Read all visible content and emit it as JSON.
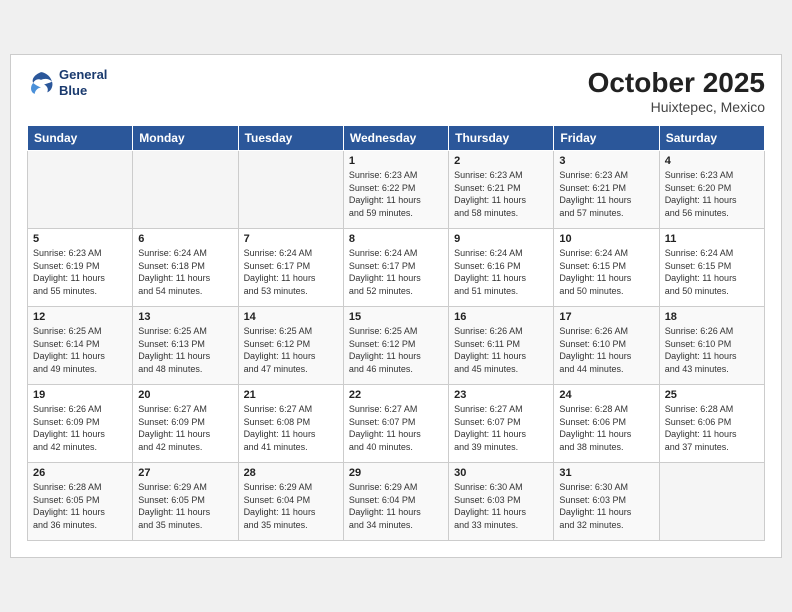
{
  "header": {
    "logo_line1": "General",
    "logo_line2": "Blue",
    "month": "October 2025",
    "location": "Huixtepec, Mexico"
  },
  "weekdays": [
    "Sunday",
    "Monday",
    "Tuesday",
    "Wednesday",
    "Thursday",
    "Friday",
    "Saturday"
  ],
  "weeks": [
    [
      {
        "day": "",
        "info": ""
      },
      {
        "day": "",
        "info": ""
      },
      {
        "day": "",
        "info": ""
      },
      {
        "day": "1",
        "info": "Sunrise: 6:23 AM\nSunset: 6:22 PM\nDaylight: 11 hours\nand 59 minutes."
      },
      {
        "day": "2",
        "info": "Sunrise: 6:23 AM\nSunset: 6:21 PM\nDaylight: 11 hours\nand 58 minutes."
      },
      {
        "day": "3",
        "info": "Sunrise: 6:23 AM\nSunset: 6:21 PM\nDaylight: 11 hours\nand 57 minutes."
      },
      {
        "day": "4",
        "info": "Sunrise: 6:23 AM\nSunset: 6:20 PM\nDaylight: 11 hours\nand 56 minutes."
      }
    ],
    [
      {
        "day": "5",
        "info": "Sunrise: 6:23 AM\nSunset: 6:19 PM\nDaylight: 11 hours\nand 55 minutes."
      },
      {
        "day": "6",
        "info": "Sunrise: 6:24 AM\nSunset: 6:18 PM\nDaylight: 11 hours\nand 54 minutes."
      },
      {
        "day": "7",
        "info": "Sunrise: 6:24 AM\nSunset: 6:17 PM\nDaylight: 11 hours\nand 53 minutes."
      },
      {
        "day": "8",
        "info": "Sunrise: 6:24 AM\nSunset: 6:17 PM\nDaylight: 11 hours\nand 52 minutes."
      },
      {
        "day": "9",
        "info": "Sunrise: 6:24 AM\nSunset: 6:16 PM\nDaylight: 11 hours\nand 51 minutes."
      },
      {
        "day": "10",
        "info": "Sunrise: 6:24 AM\nSunset: 6:15 PM\nDaylight: 11 hours\nand 50 minutes."
      },
      {
        "day": "11",
        "info": "Sunrise: 6:24 AM\nSunset: 6:15 PM\nDaylight: 11 hours\nand 50 minutes."
      }
    ],
    [
      {
        "day": "12",
        "info": "Sunrise: 6:25 AM\nSunset: 6:14 PM\nDaylight: 11 hours\nand 49 minutes."
      },
      {
        "day": "13",
        "info": "Sunrise: 6:25 AM\nSunset: 6:13 PM\nDaylight: 11 hours\nand 48 minutes."
      },
      {
        "day": "14",
        "info": "Sunrise: 6:25 AM\nSunset: 6:12 PM\nDaylight: 11 hours\nand 47 minutes."
      },
      {
        "day": "15",
        "info": "Sunrise: 6:25 AM\nSunset: 6:12 PM\nDaylight: 11 hours\nand 46 minutes."
      },
      {
        "day": "16",
        "info": "Sunrise: 6:26 AM\nSunset: 6:11 PM\nDaylight: 11 hours\nand 45 minutes."
      },
      {
        "day": "17",
        "info": "Sunrise: 6:26 AM\nSunset: 6:10 PM\nDaylight: 11 hours\nand 44 minutes."
      },
      {
        "day": "18",
        "info": "Sunrise: 6:26 AM\nSunset: 6:10 PM\nDaylight: 11 hours\nand 43 minutes."
      }
    ],
    [
      {
        "day": "19",
        "info": "Sunrise: 6:26 AM\nSunset: 6:09 PM\nDaylight: 11 hours\nand 42 minutes."
      },
      {
        "day": "20",
        "info": "Sunrise: 6:27 AM\nSunset: 6:09 PM\nDaylight: 11 hours\nand 42 minutes."
      },
      {
        "day": "21",
        "info": "Sunrise: 6:27 AM\nSunset: 6:08 PM\nDaylight: 11 hours\nand 41 minutes."
      },
      {
        "day": "22",
        "info": "Sunrise: 6:27 AM\nSunset: 6:07 PM\nDaylight: 11 hours\nand 40 minutes."
      },
      {
        "day": "23",
        "info": "Sunrise: 6:27 AM\nSunset: 6:07 PM\nDaylight: 11 hours\nand 39 minutes."
      },
      {
        "day": "24",
        "info": "Sunrise: 6:28 AM\nSunset: 6:06 PM\nDaylight: 11 hours\nand 38 minutes."
      },
      {
        "day": "25",
        "info": "Sunrise: 6:28 AM\nSunset: 6:06 PM\nDaylight: 11 hours\nand 37 minutes."
      }
    ],
    [
      {
        "day": "26",
        "info": "Sunrise: 6:28 AM\nSunset: 6:05 PM\nDaylight: 11 hours\nand 36 minutes."
      },
      {
        "day": "27",
        "info": "Sunrise: 6:29 AM\nSunset: 6:05 PM\nDaylight: 11 hours\nand 35 minutes."
      },
      {
        "day": "28",
        "info": "Sunrise: 6:29 AM\nSunset: 6:04 PM\nDaylight: 11 hours\nand 35 minutes."
      },
      {
        "day": "29",
        "info": "Sunrise: 6:29 AM\nSunset: 6:04 PM\nDaylight: 11 hours\nand 34 minutes."
      },
      {
        "day": "30",
        "info": "Sunrise: 6:30 AM\nSunset: 6:03 PM\nDaylight: 11 hours\nand 33 minutes."
      },
      {
        "day": "31",
        "info": "Sunrise: 6:30 AM\nSunset: 6:03 PM\nDaylight: 11 hours\nand 32 minutes."
      },
      {
        "day": "",
        "info": ""
      }
    ]
  ]
}
